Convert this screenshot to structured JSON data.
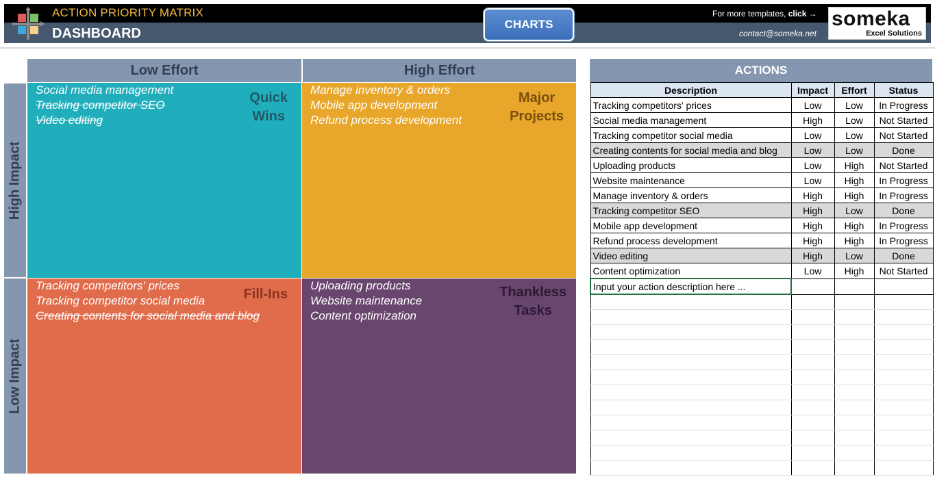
{
  "header": {
    "title": "ACTION PRIORITY MATRIX",
    "subtitle": "DASHBOARD",
    "charts_button": "CHARTS",
    "more_templates": "For more templates,",
    "click_label": "click →",
    "contact": "contact@someka.net",
    "brand_name": "someka",
    "brand_sub": "Excel Solutions"
  },
  "matrix": {
    "col_low": "Low Effort",
    "col_high": "High Effort",
    "row_high": "High Impact",
    "row_low": "Low Impact",
    "quick_wins": {
      "label_line1": "Quick",
      "label_line2": "Wins",
      "items": [
        "Social media management",
        "Tracking competitor SEO",
        "Video editing"
      ],
      "color": "#21aebc"
    },
    "major_projects": {
      "label_line1": "Major",
      "label_line2": "Projects",
      "items": [
        "Manage inventory & orders",
        "Mobile app development",
        "Refund process development"
      ],
      "color": "#e8a72a"
    },
    "fill_ins": {
      "label": "Fill-Ins",
      "items": [
        "Tracking competitors' prices",
        "Tracking competitor social media",
        "Creating contents for social media and blog"
      ],
      "color": "#e06c4b"
    },
    "thankless": {
      "label_line1": "Thankless",
      "label_line2": "Tasks",
      "items": [
        "Uploading products",
        "Website maintenance",
        "Content optimization"
      ],
      "color": "#69466e"
    }
  },
  "actions": {
    "title": "ACTIONS",
    "columns": [
      "Description",
      "Impact",
      "Effort",
      "Status"
    ],
    "rows": [
      {
        "description": "Tracking competitors' prices",
        "impact": "Low",
        "effort": "Low",
        "status": "In Progress"
      },
      {
        "description": "Social media management",
        "impact": "High",
        "effort": "Low",
        "status": "Not Started"
      },
      {
        "description": "Tracking competitor social media",
        "impact": "Low",
        "effort": "Low",
        "status": "Not Started"
      },
      {
        "description": "Creating contents for social media and blog",
        "impact": "Low",
        "effort": "Low",
        "status": "Done"
      },
      {
        "description": "Uploading products",
        "impact": "Low",
        "effort": "High",
        "status": "Not Started"
      },
      {
        "description": "Website maintenance",
        "impact": "Low",
        "effort": "High",
        "status": "In Progress"
      },
      {
        "description": "Manage inventory & orders",
        "impact": "High",
        "effort": "High",
        "status": "In Progress"
      },
      {
        "description": "Tracking competitor SEO",
        "impact": "High",
        "effort": "Low",
        "status": "Done"
      },
      {
        "description": "Mobile app development",
        "impact": "High",
        "effort": "High",
        "status": "In Progress"
      },
      {
        "description": "Refund process development",
        "impact": "High",
        "effort": "High",
        "status": "In Progress"
      },
      {
        "description": "Video editing",
        "impact": "High",
        "effort": "Low",
        "status": "Done"
      },
      {
        "description": "Content optimization",
        "impact": "Low",
        "effort": "High",
        "status": "Not Started"
      }
    ],
    "input_placeholder": "Input your action description here ..."
  }
}
